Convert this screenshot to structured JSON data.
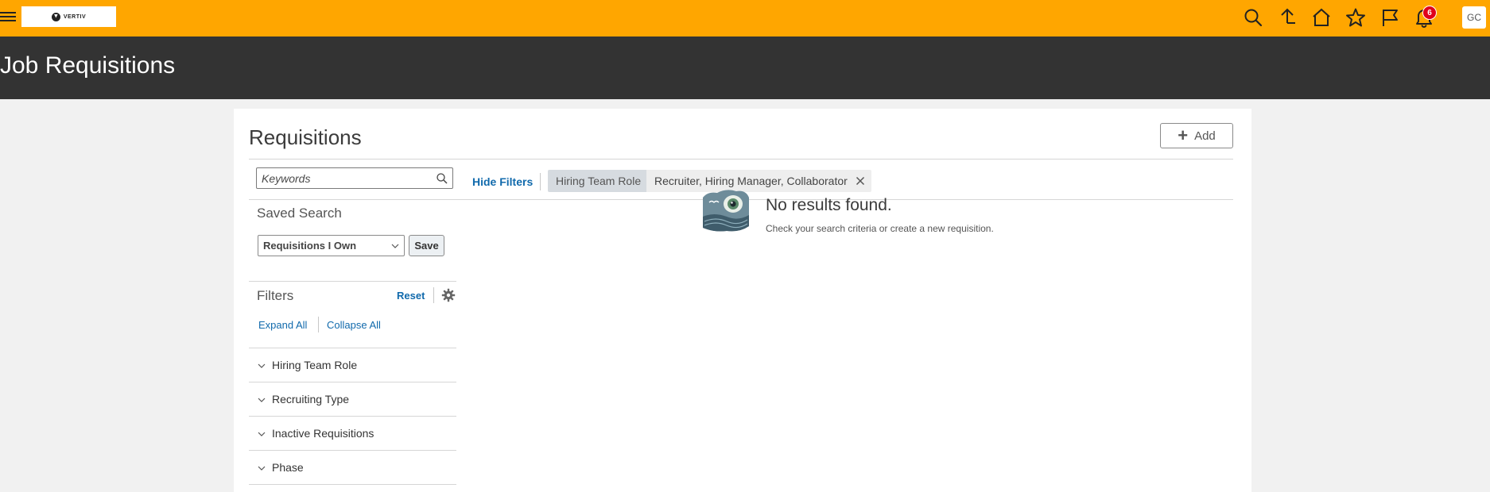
{
  "brand": {
    "logo_text": "VERTIV"
  },
  "header": {
    "notification_count": "6",
    "user_initials": "GC",
    "icons": [
      "hamburger-icon",
      "search-icon",
      "upload-icon",
      "home-icon",
      "star-icon",
      "flag-icon",
      "bell-icon"
    ]
  },
  "page": {
    "title": "Job Requisitions"
  },
  "card": {
    "title": "Requisitions",
    "add_label": "Add"
  },
  "search": {
    "placeholder": "Keywords",
    "value": ""
  },
  "filter_bar": {
    "hide_filters_label": "Hide Filters",
    "chip_label": "Hiring Team Role",
    "chip_value": "Recruiter, Hiring Manager, Collaborator"
  },
  "saved_search": {
    "heading": "Saved Search",
    "selected": "Requisitions I Own",
    "save_label": "Save"
  },
  "filters": {
    "heading": "Filters",
    "reset_label": "Reset",
    "expand_all_label": "Expand All",
    "collapse_all_label": "Collapse All",
    "facets": [
      {
        "label": "Hiring Team Role"
      },
      {
        "label": "Recruiting Type"
      },
      {
        "label": "Inactive Requisitions"
      },
      {
        "label": "Phase"
      }
    ]
  },
  "empty_state": {
    "title": "No results found.",
    "subtitle": "Check your search criteria or create a new requisition."
  },
  "colors": {
    "topbar": "#ffa600",
    "titlebar": "#333333",
    "link": "#116aac",
    "badge": "#e0001b"
  }
}
